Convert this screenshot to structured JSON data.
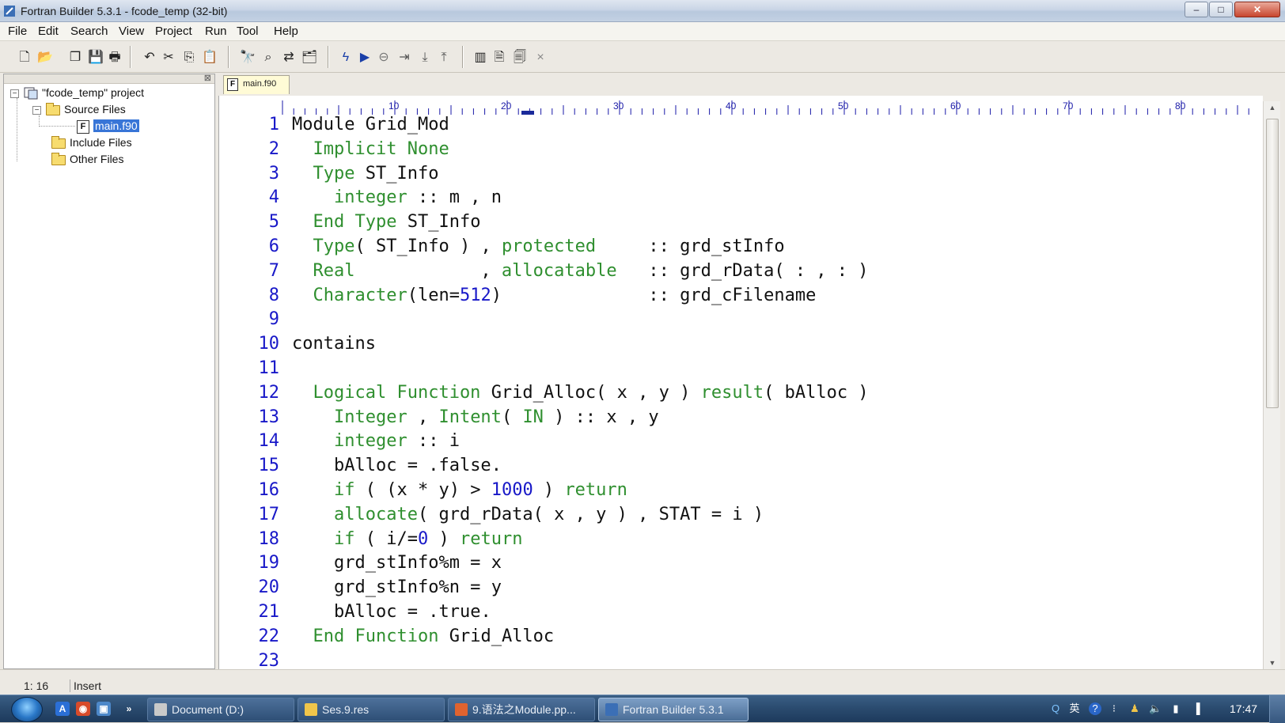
{
  "window": {
    "title": "Fortran Builder 5.3.1 - fcode_temp (32-bit)",
    "minimize": "–",
    "maximize": "□",
    "close": "✕"
  },
  "menu": [
    "File",
    "Edit",
    "Search",
    "View",
    "Project",
    "Run",
    "Tool",
    "Help"
  ],
  "toolbar": {
    "icons": [
      "new-file-icon",
      "open-file-icon",
      "copy-file-icon",
      "save-icon",
      "print-icon",
      "undo-icon",
      "cut-icon",
      "copy-icon",
      "paste-icon",
      "find-icon",
      "find-next-icon",
      "replace-icon",
      "find-in-files-icon",
      "build-icon",
      "run-icon",
      "stop-icon",
      "step-icon",
      "step-into-icon",
      "step-out-icon",
      "layout-icon",
      "compile-icon",
      "link-icon",
      "close-doc-icon"
    ],
    "close_glyph": "×"
  },
  "project_tree": {
    "root": "\"fcode_temp\" project",
    "source_files": "Source Files",
    "selected_file": "main.f90",
    "include_files": "Include Files",
    "other_files": "Other Files",
    "file_type_glyph": "F",
    "collapse_glyph": "−"
  },
  "tabs": [
    {
      "label": "main.f90",
      "icon": "F"
    }
  ],
  "ruler": {
    "marks": [
      "10",
      "20",
      "30",
      "40",
      "50",
      "60",
      "70",
      "80"
    ]
  },
  "editor": {
    "line_numbers": [
      "1",
      "2",
      "3",
      "4",
      "5",
      "6",
      "7",
      "8",
      "9",
      "10",
      "11",
      "12",
      "13",
      "14",
      "15",
      "16",
      "17",
      "18",
      "19",
      "20",
      "21",
      "22",
      "23"
    ],
    "lines": [
      "Module Grid_Mod",
      "  Implicit None",
      "  Type ST_Info",
      "    integer :: m , n",
      "  End Type ST_Info",
      "  Type( ST_Info ) , protected     :: grd_stInfo",
      "  Real            , allocatable   :: grd_rData( : , : )",
      "  Character(len=512)              :: grd_cFilename",
      "",
      "contains",
      "",
      "  Logical Function Grid_Alloc( x , y ) result( bAlloc )",
      "    Integer , Intent( IN ) :: x , y",
      "    integer :: i",
      "    bAlloc = .false.",
      "    if ( (x * y) > 1000 ) return",
      "    allocate( grd_rData( x , y ) , STAT = i )",
      "    if ( i/=0 ) return",
      "    grd_stInfo%m = x",
      "    grd_stInfo%n = y",
      "    bAlloc = .true.",
      "  End Function Grid_Alloc",
      ""
    ]
  },
  "statusbar": {
    "position": "1: 16",
    "mode": "Insert"
  },
  "taskbar": {
    "quick_launch": [
      "A",
      "◉",
      "▣",
      "»"
    ],
    "tasks": [
      {
        "label": "Document (D:)",
        "active": false
      },
      {
        "label": "Ses.9.res",
        "active": false
      },
      {
        "label": "9.语法之Module.pp...",
        "active": false
      },
      {
        "label": "Fortran Builder 5.3.1",
        "active": true
      }
    ],
    "tray": [
      "Q",
      "英",
      "?",
      "⁝",
      "♟",
      "🔈",
      "▮",
      "▐"
    ],
    "clock": "17:47"
  },
  "colors": {
    "keyword": "#2f8f2f",
    "line_number": "#1818c8",
    "number": "#1818c8",
    "selection": "#3875d7"
  }
}
